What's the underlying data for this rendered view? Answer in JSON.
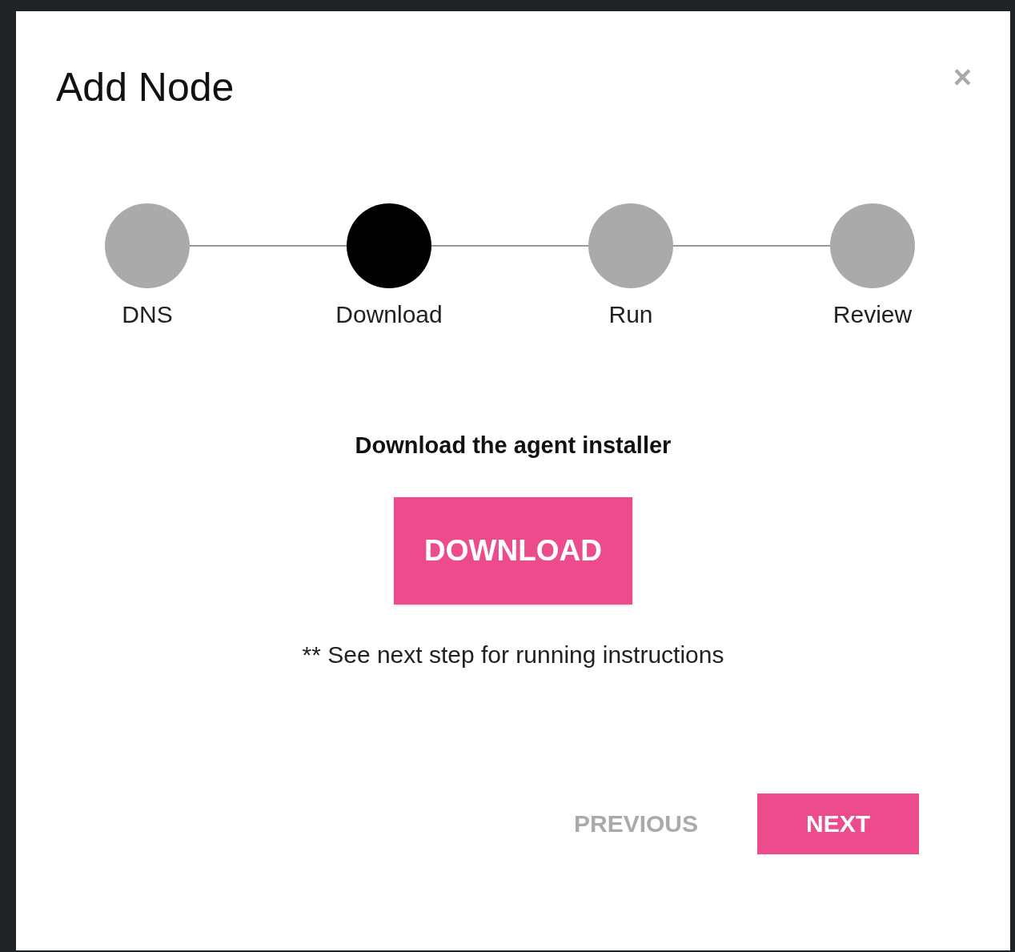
{
  "dialog": {
    "title": "Add Node",
    "close": "×"
  },
  "steps": [
    {
      "label": "DNS",
      "selected": false
    },
    {
      "label": "Download",
      "selected": true
    },
    {
      "label": "Run",
      "selected": false
    },
    {
      "label": "Review",
      "selected": false
    }
  ],
  "content": {
    "heading": "Download the agent installer",
    "button": "DOWNLOAD",
    "note": "** See next step for running instructions"
  },
  "footer": {
    "previous": {
      "label": "PREVIOUS",
      "disabled": true
    },
    "next": {
      "label": "NEXT",
      "disabled": false
    }
  }
}
